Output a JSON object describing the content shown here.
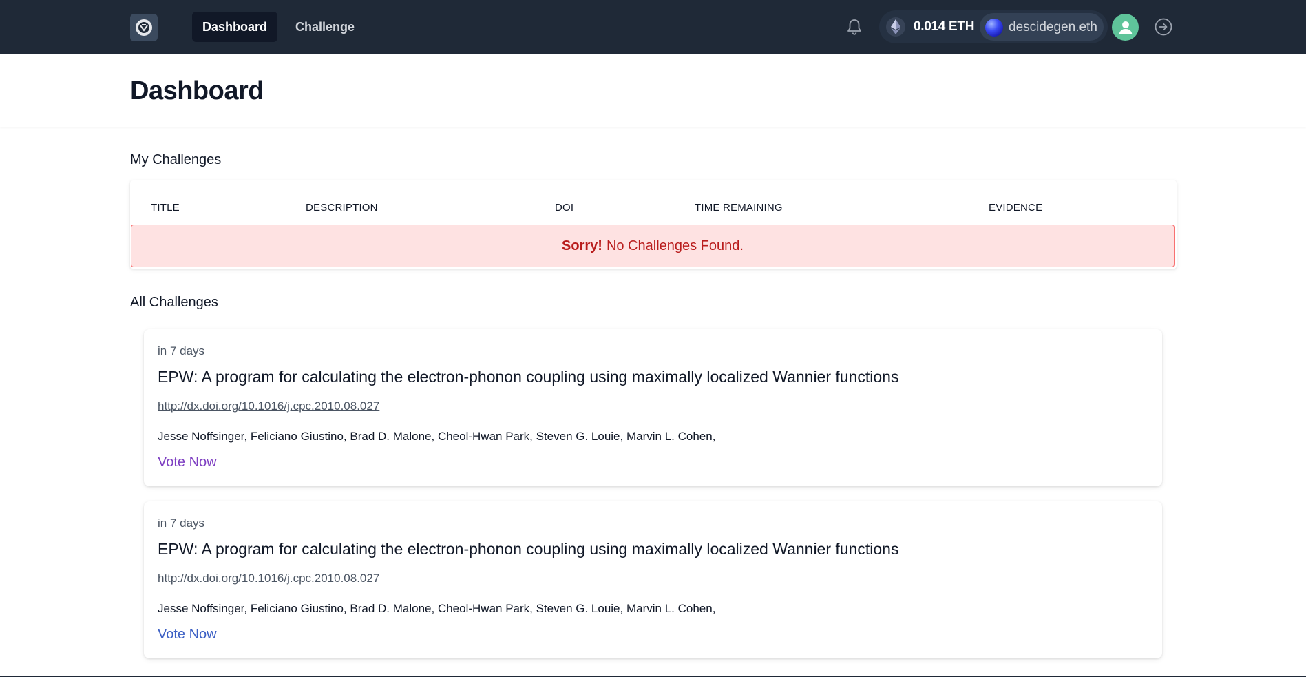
{
  "nav": {
    "tabs": [
      {
        "label": "Dashboard",
        "active": true
      },
      {
        "label": "Challenge",
        "active": false
      }
    ],
    "balance": "0.014 ETH",
    "ens_name": "descidegen.eth"
  },
  "header": {
    "title": "Dashboard"
  },
  "my_challenges": {
    "title": "My Challenges",
    "columns": [
      "TITLE",
      "DESCRIPTION",
      "DOI",
      "TIME REMAINING",
      "EVIDENCE"
    ],
    "empty_alert": {
      "strong": "Sorry!",
      "message": "No Challenges Found."
    }
  },
  "all_challenges": {
    "title": "All Challenges",
    "items": [
      {
        "time": "in 7 days",
        "title": "EPW: A program for calculating the electron-phonon coupling using maximally localized Wannier functions",
        "doi": "http://dx.doi.org/10.1016/j.cpc.2010.08.027",
        "authors": "Jesse Noffsinger, Feliciano Giustino, Brad D. Malone, Cheol-Hwan Park, Steven G. Louie, Marvin L. Cohen,",
        "vote_label": "Vote Now",
        "vote_color": "#7e3fc2"
      },
      {
        "time": "in 7 days",
        "title": "EPW: A program for calculating the electron-phonon coupling using maximally localized Wannier functions",
        "doi": "http://dx.doi.org/10.1016/j.cpc.2010.08.027",
        "authors": "Jesse Noffsinger, Feliciano Giustino, Brad D. Malone, Cheol-Hwan Park, Steven G. Louie, Marvin L. Cohen,",
        "vote_label": "Vote Now",
        "vote_color": "#3b5fc4"
      }
    ]
  },
  "colors": {
    "nav_bg": "#1f2937",
    "alert_bg": "#fee2e2",
    "alert_text": "#b91c1c",
    "avatar_green": "#5fc49a"
  },
  "icons": {
    "logo": "app-logo-icon",
    "notifications": "bell-icon",
    "currency": "ethereum-icon",
    "ens_avatar": "ens-avatar",
    "profile": "user-icon",
    "logout": "arrow-right-circle-icon"
  }
}
